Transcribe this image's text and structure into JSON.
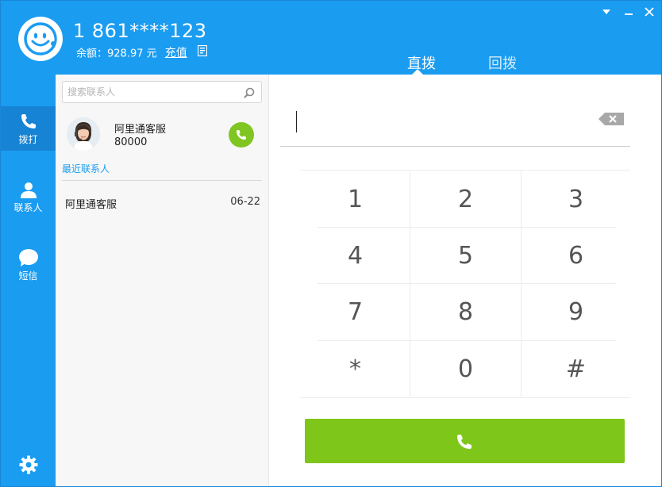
{
  "header": {
    "phone_number": "1 861****123",
    "balance_label": "余额：",
    "balance_value": "928.97 元",
    "recharge_label": "充值"
  },
  "tabs": [
    {
      "label": "直拨",
      "active": true
    },
    {
      "label": "回拨",
      "active": false
    }
  ],
  "sidebar": {
    "items": [
      {
        "label": "拨打",
        "icon": "phone-icon",
        "active": true
      },
      {
        "label": "联系人",
        "icon": "person-icon",
        "active": false
      },
      {
        "label": "短信",
        "icon": "chat-bubble-icon",
        "active": false
      }
    ],
    "settings_icon": "gear-icon"
  },
  "contacts": {
    "search_placeholder": "搜索联系人",
    "service": {
      "name": "阿里通客服",
      "number": "80000"
    },
    "recent_title": "最近联系人",
    "recent": [
      {
        "name": "阿里通客服",
        "date": "06-22"
      }
    ]
  },
  "dialer": {
    "value": "",
    "keys": [
      "1",
      "2",
      "3",
      "4",
      "5",
      "6",
      "7",
      "8",
      "9",
      "*",
      "0",
      "#"
    ]
  },
  "colors": {
    "brand_blue": "#1a9cf1",
    "active_nav": "#1683d4",
    "call_green": "#7fc61b"
  }
}
